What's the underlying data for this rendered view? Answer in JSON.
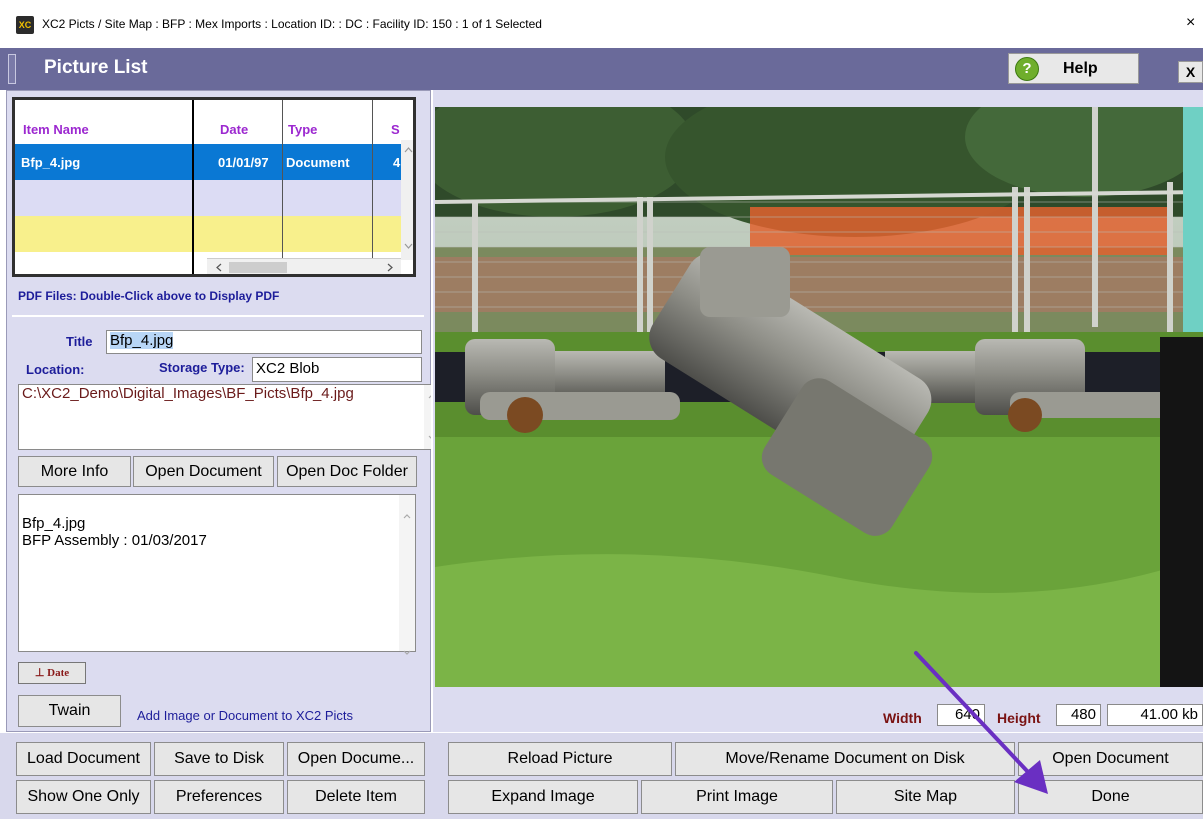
{
  "window": {
    "icon_text": "XC",
    "title": "XC2 Picts / Site Map :  BFP : Mex Imports : Location ID:  : DC : Facility ID:  150 : 1 of 1 Selected",
    "close_glyph": "×"
  },
  "header": {
    "title": "Picture List",
    "help_label": "Help",
    "help_icon_glyph": "?",
    "close_label": "X"
  },
  "table": {
    "columns": [
      "Item Name",
      "Date",
      "Type",
      "S"
    ],
    "rows": [
      {
        "name": "Bfp_4.jpg",
        "date": "01/01/97",
        "type": "Document",
        "size": "4"
      }
    ],
    "selected_color": "#0a78d4",
    "alt_row_colors": [
      "#dcdcf4",
      "#f8f08c"
    ]
  },
  "pdf_note": "PDF Files:  Double-Click above to Display PDF",
  "details": {
    "title_label": "Title",
    "title_value": "Bfp_4.jpg",
    "location_label": "Location:",
    "storage_label": "Storage Type:",
    "storage_value": "XC2 Blob",
    "path_value": "C:\\XC2_Demo\\Digital_Images\\BF_Picts\\Bfp_4.jpg"
  },
  "buttons": {
    "more_info": "More Info",
    "open_document": "Open Document",
    "open_doc_folder": "Open Doc Folder",
    "date": "Date",
    "twain": "Twain"
  },
  "notes_text": "Bfp_4.jpg\nBFP Assembly  :  01/03/2017",
  "add_note": "Add Image or Document to XC2 Picts",
  "image_info": {
    "width_label": "Width",
    "width_value": "640",
    "height_label": "Height",
    "height_value": "480",
    "size_value": "41.00 kb"
  },
  "bottom": {
    "load_document": "Load Document",
    "save_to_disk": "Save to Disk",
    "open_document_short": "Open Docume...",
    "show_one_only": "Show One Only",
    "preferences": "Preferences",
    "delete_item": "Delete Item",
    "reload_picture": "Reload Picture",
    "move_rename": "Move/Rename Document on Disk",
    "open_document": "Open Document",
    "expand_image": "Expand Image",
    "print_image": "Print Image",
    "site_map": "Site Map",
    "done": "Done"
  },
  "colors": {
    "header_bg": "#6a6a9a",
    "panel_bg": "#dcdcf0",
    "label_blue": "#1d1d9a",
    "arrow_purple": "#6a2fc2"
  }
}
